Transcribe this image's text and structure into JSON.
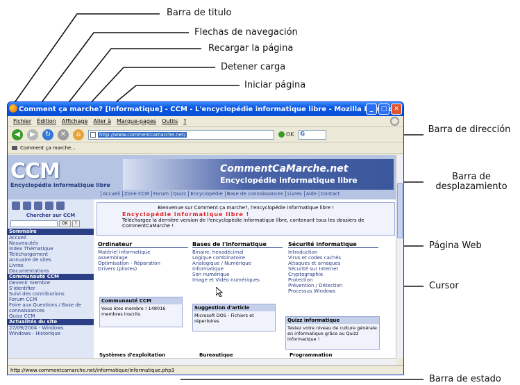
{
  "annotations": {
    "title_bar": "Barra de titulo",
    "nav_arrows": "Flechas de navegación",
    "reload": "Recargar la página",
    "stop": "Detener carga",
    "home": "Iniciar página",
    "address_bar": "Barra de dirección",
    "scrollbar": "Barra de desplazamiento",
    "web_page": "Página Web",
    "cursor": "Cursor",
    "status_bar": "Barra de estado"
  },
  "window": {
    "title": "Comment ça marche? [Informatique] - CCM - L'encyclopédie informatique libre - Mozilla Firefox"
  },
  "menu": [
    "Fichier",
    "Édition",
    "Affichage",
    "Aller à",
    "Marque-pages",
    "Outils",
    "?"
  ],
  "address": {
    "url": "http://www.commentcamarche.net/",
    "go_label": "OK",
    "search_engine": "G"
  },
  "bookmark": "Comment ça marche...",
  "page": {
    "logo": "CCM",
    "encyclopedia": "Encyclopédie informatique libre",
    "banner_title": "CommentCaMarche.net",
    "banner_subtitle": "Encyclopédie informatique libre",
    "tabs": [
      "Accueil",
      "Zone CCM",
      "Forum",
      "Quizz",
      "Encyclopédie",
      "Base de connaissances",
      "Livres",
      "Aide",
      "Contact"
    ],
    "search_title": "Chercher sur CCM",
    "search_ok": "OK",
    "search_help": "?",
    "sommaire": "Sommaire",
    "sommaire_items": [
      "Accueil",
      "Nouveautés",
      "Index Thématique",
      "Téléchargement",
      "Annuaire de sites",
      "Livres",
      "Documentations"
    ],
    "communaute": "Communauté CCM",
    "communaute_items": [
      "Devenir membre",
      "S'identifier",
      "Suivi des contributions",
      "Forum CCM",
      "Foire aux Questions / Base de connaissances",
      "Quizz CCM"
    ],
    "actualites": "Actualités du site",
    "actualites_items": [
      "27/09/2004 - Windows",
      "Windows - Historique"
    ],
    "welcome": "Bienvenue sur Comment ça marche?, l'encyclopédie informatique libre !",
    "welcome_red": "Encyclopédie informatique libre !",
    "welcome_text": "Téléchargez la dernière version de l'encyclopédie informatique libre, contenant tous les dossiers de CommentCaMarche !",
    "col1_head": "Ordinateur",
    "col1_items": [
      "Matériel informatique",
      "Assemblage",
      "Optimisation - Réparation",
      "Drivers (pilotes)"
    ],
    "col2_head": "Bases de l'informatique",
    "col2_items": [
      "Binaire, hexadécimal",
      "Logique combinatoire",
      "Analogique / Numérique",
      "Informatique",
      "Son numérique",
      "Image et Vidéo numériques"
    ],
    "col3_head": "Sécurité informatique",
    "col3_items": [
      "Introduction",
      "Virus et codes cachés",
      "Attaques et arnaques",
      "Sécurité sur Internet",
      "Cryptographie",
      "Protection",
      "Prévention / Détection",
      "Processus Windows"
    ],
    "comm_box_head": "Communauté CCM",
    "comm_box_text": "Vous êtes membre ! 148016 membres inscrits",
    "suggest_head": "Suggestion d'article",
    "suggest_text": "Microsoft DOS - Fichiers et répertoires",
    "quiz_head": "Quizz informatique",
    "quiz_text": "Testez votre niveau de culture générale en informatique grâce au Quizz informatique !",
    "bottom_heads": [
      "Systèmes d'exploitation",
      "Bureautique",
      "Programmation"
    ]
  },
  "status_bar": "http://www.commentcamarche.net/informatique/informatique.php3"
}
